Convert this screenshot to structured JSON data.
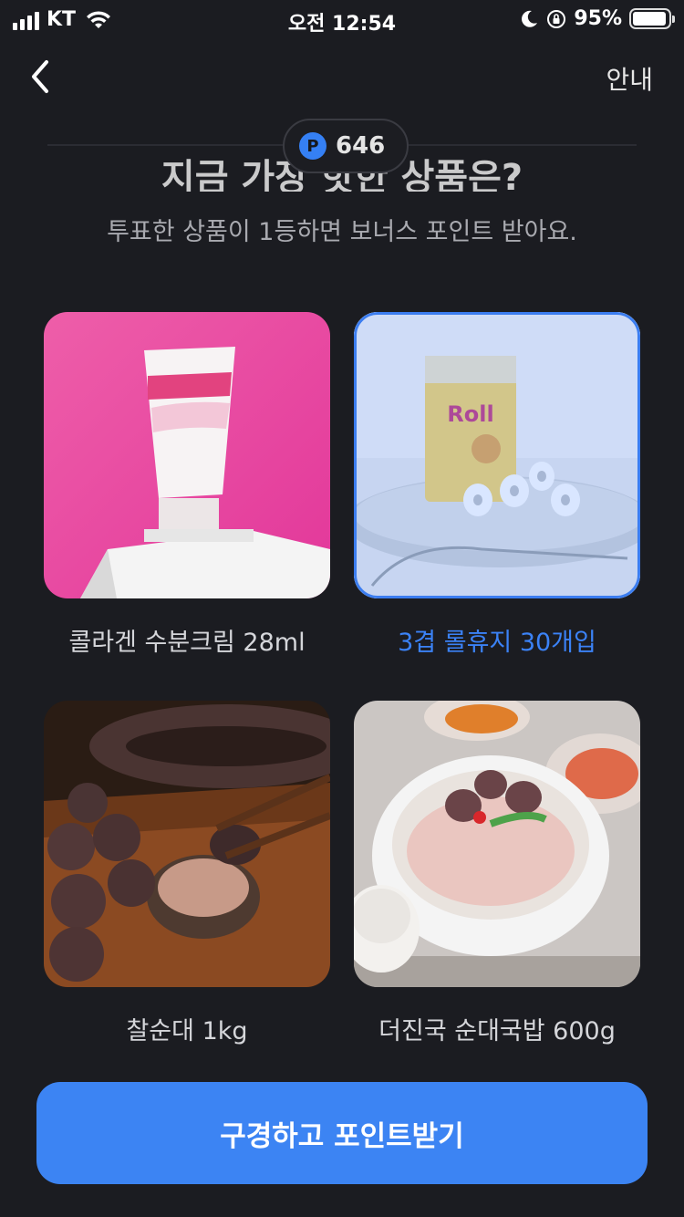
{
  "status_bar": {
    "carrier": "KT",
    "time": "오전 12:54",
    "battery_pct": "95%",
    "icons": [
      "cellular-signal-icon",
      "wifi-icon",
      "moon-icon",
      "orientation-lock-icon",
      "battery-icon"
    ]
  },
  "nav": {
    "back_icon": "chevron-left-icon",
    "guide_label": "안내"
  },
  "header": {
    "title": "지금 가장 핫한 상품은?",
    "points_badge": "P",
    "points_value": "646",
    "subtitle": "투표한 상품이 1등하면 보너스 포인트 받아요."
  },
  "products": [
    {
      "label": "콜라겐 수분크림 28ml",
      "selected": false
    },
    {
      "label": "3겹 롤휴지 30개입",
      "selected": true
    },
    {
      "label": "찰순대 1kg",
      "selected": false
    },
    {
      "label": "더진국 순대국밥 600g",
      "selected": false
    }
  ],
  "cta": {
    "label": "구경하고 포인트받기"
  },
  "colors": {
    "background": "#1b1c21",
    "accent": "#3c84f3",
    "selected_label": "#3b82f6"
  }
}
